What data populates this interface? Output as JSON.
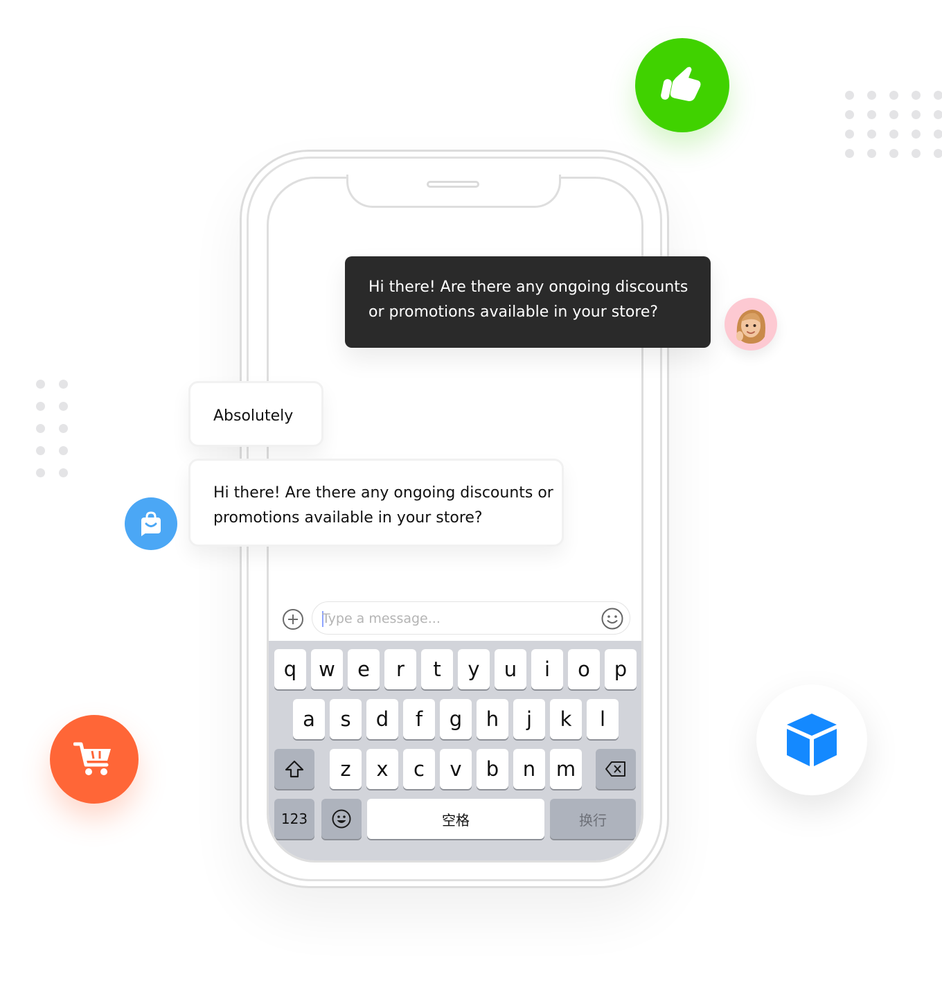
{
  "chat": {
    "incoming_message": "Hi there! Are there any ongoing discounts or promotions available in your store?",
    "reply_short": "Absolutely",
    "reply_long": "Hi there! Are there any ongoing discounts or promotions available in your store?"
  },
  "composer": {
    "placeholder": "Type a message...",
    "attach_icon": "plus-circle-icon",
    "emoji_icon": "smiley-icon"
  },
  "keyboard": {
    "row1": [
      "q",
      "w",
      "e",
      "r",
      "t",
      "y",
      "u",
      "i",
      "o",
      "p"
    ],
    "row2": [
      "a",
      "s",
      "d",
      "f",
      "g",
      "h",
      "j",
      "k",
      "l"
    ],
    "row3": [
      "z",
      "x",
      "c",
      "v",
      "b",
      "n",
      "m"
    ],
    "numbers_label": "123",
    "space_label": "空格",
    "return_label": "换行",
    "shift_icon": "shift-arrow-icon",
    "delete_icon": "backspace-icon",
    "emoji_icon": "emoji-face-icon"
  },
  "badges": {
    "thumbs_up": "thumbs-up-icon",
    "cart": "shopping-cart-icon",
    "box": "package-box-icon",
    "bag": "shopping-bag-icon",
    "avatar": "user-avatar"
  },
  "colors": {
    "green": "#40d200",
    "orange": "#ff6637",
    "blue_box": "#1489ff",
    "blue_bag": "#4ba7f5",
    "dark_bubble": "#2a2a2a",
    "keyboard_bg": "#d2d4da"
  }
}
